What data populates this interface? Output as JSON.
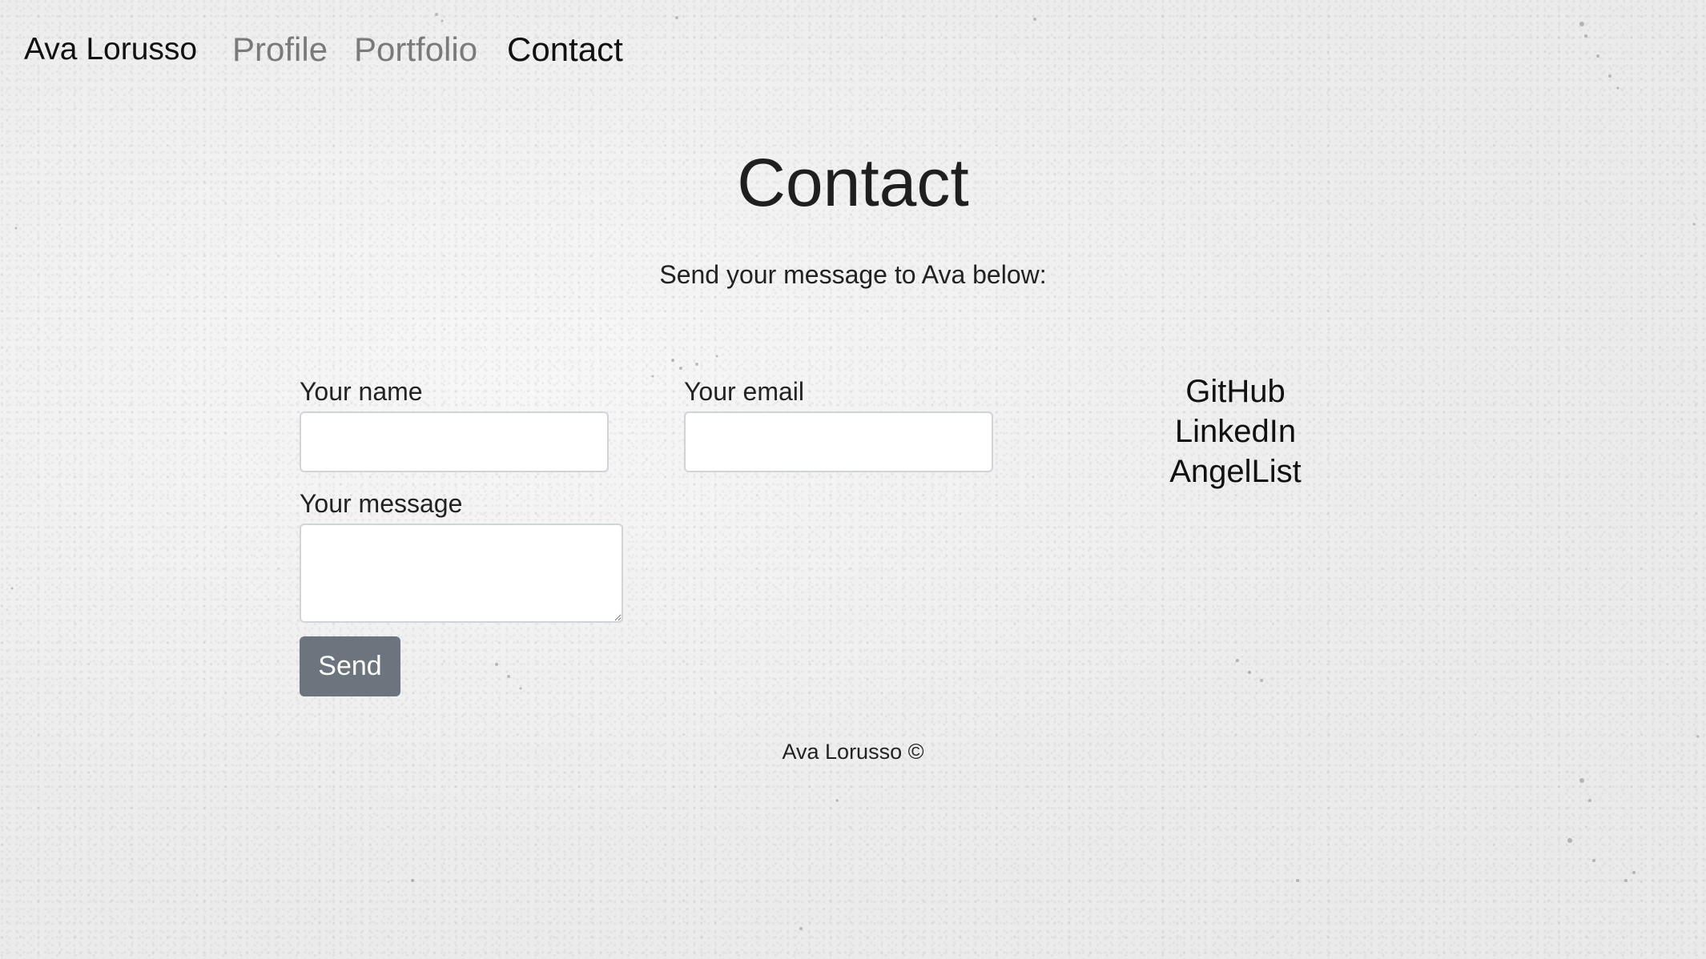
{
  "nav": {
    "brand": "Ava Lorusso",
    "links": [
      {
        "label": "Profile",
        "active": false
      },
      {
        "label": "Portfolio",
        "active": false
      },
      {
        "label": "Contact",
        "active": true
      }
    ]
  },
  "main": {
    "title": "Contact",
    "subtitle": "Send your message to Ava below:",
    "form": {
      "name_label": "Your name",
      "name_value": "",
      "email_label": "Your email",
      "email_value": "",
      "message_label": "Your message",
      "message_value": "",
      "send_label": "Send"
    },
    "social_links": [
      "GitHub",
      "LinkedIn",
      "AngelList"
    ]
  },
  "footer": {
    "text": "Ava Lorusso ©"
  },
  "colors": {
    "background": "#eeeeee",
    "button": "#6c757d",
    "nav_inactive": "#7a7a7a",
    "nav_active": "#111111"
  }
}
